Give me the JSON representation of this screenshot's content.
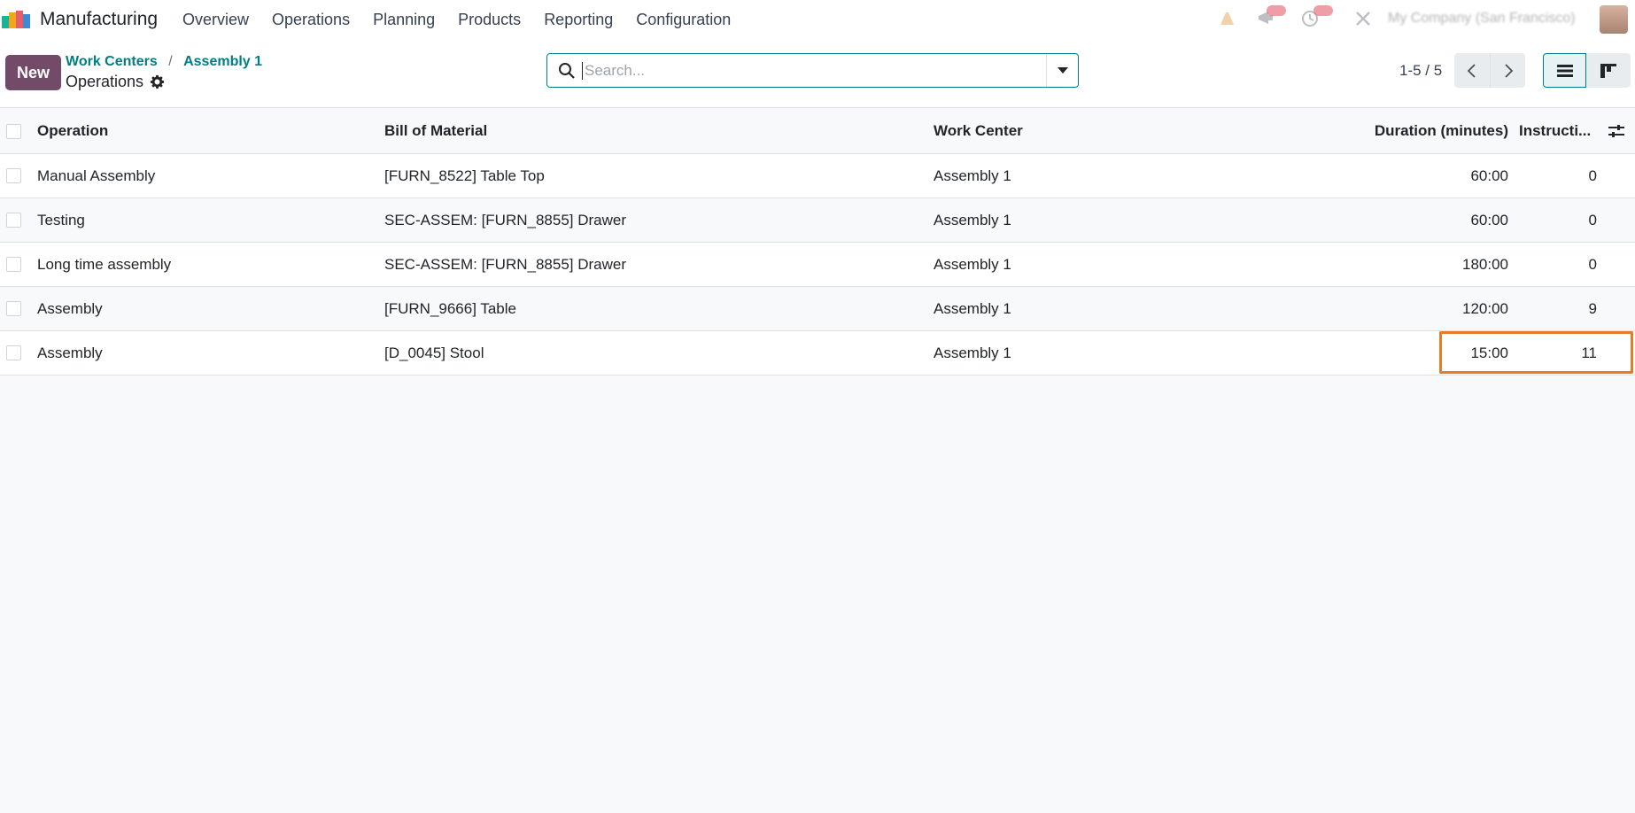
{
  "navbar": {
    "app_name": "Manufacturing",
    "menu": [
      "Overview",
      "Operations",
      "Planning",
      "Products",
      "Reporting",
      "Configuration"
    ],
    "company": "My Company (San Francisco)"
  },
  "control_panel": {
    "new_label": "New",
    "breadcrumb": [
      "Work Centers",
      "Assembly 1"
    ],
    "breadcrumb_separator": "/",
    "title": "Operations",
    "search_placeholder": "Search...",
    "pager": "1-5 / 5"
  },
  "table": {
    "headers": {
      "operation": "Operation",
      "bom": "Bill of Material",
      "work_center": "Work Center",
      "duration": "Duration (minutes)",
      "instructions": "Instructi..."
    },
    "rows": [
      {
        "operation": "Manual Assembly",
        "bom": "[FURN_8522] Table Top",
        "work_center": "Assembly 1",
        "duration": "60:00",
        "instructions": "0"
      },
      {
        "operation": "Testing",
        "bom": "SEC-ASSEM: [FURN_8855] Drawer",
        "work_center": "Assembly 1",
        "duration": "60:00",
        "instructions": "0"
      },
      {
        "operation": "Long time assembly",
        "bom": "SEC-ASSEM: [FURN_8855] Drawer",
        "work_center": "Assembly 1",
        "duration": "180:00",
        "instructions": "0"
      },
      {
        "operation": "Assembly",
        "bom": "[FURN_9666] Table",
        "work_center": "Assembly 1",
        "duration": "120:00",
        "instructions": "9"
      },
      {
        "operation": "Assembly",
        "bom": "[D_0045] Stool",
        "work_center": "Assembly 1",
        "duration": "15:00",
        "instructions": "11"
      }
    ]
  },
  "colors": {
    "brand": "#714b67",
    "link": "#017e84",
    "highlight": "#ec7a23"
  }
}
